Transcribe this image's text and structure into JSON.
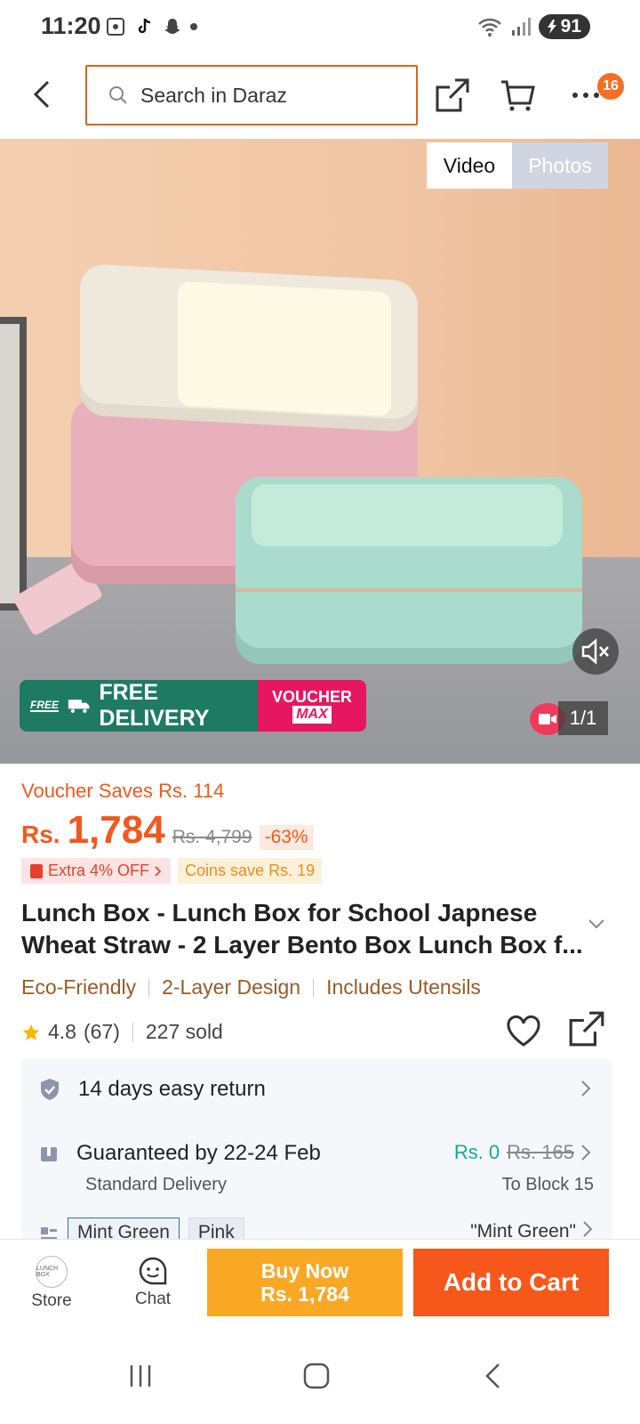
{
  "status_bar": {
    "time": "11:20",
    "battery": "91",
    "icons": [
      "screen-recorder-icon",
      "tiktok-icon",
      "snapchat-icon",
      "wifi-icon",
      "signal-icon"
    ]
  },
  "header": {
    "search_placeholder": "Search in Daraz",
    "cart_badge": "16"
  },
  "hero": {
    "tab_video": "Video",
    "tab_photos": "Photos",
    "free_tag": "FREE",
    "free_delivery": "FREE DELIVERY",
    "voucher_line1": "VOUCHER",
    "voucher_line2": "MAX",
    "page_counter": "1/1"
  },
  "price": {
    "voucher_saves": "Voucher Saves Rs. 114",
    "currency": "Rs.",
    "current": "1,784",
    "original": "Rs. 4,799",
    "discount": "-63%",
    "extra_off": "Extra 4% OFF",
    "coins_save": "Coins save Rs. 19"
  },
  "product": {
    "title": "Lunch Box - Lunch Box for School Japnese Wheat Straw - 2 Layer Bento Box Lunch Box f...",
    "features": [
      "Eco-Friendly",
      "2-Layer Design",
      "Includes Utensils"
    ],
    "rating": "4.8",
    "reviews": "(67)",
    "sold": "227 sold"
  },
  "service": {
    "return": "14 days easy return",
    "guarantee": "Guaranteed by 22-24 Feb",
    "delivery_type": "Standard Delivery",
    "delivery_fee": "Rs. 0",
    "delivery_fee_old": "Rs. 165",
    "destination": "To Block 15",
    "variants": [
      "Mint Green",
      "Pink"
    ],
    "selected_variant": "\"Mint Green\""
  },
  "action_bar": {
    "store": "Store",
    "store_logo_text": "LUNCH BOX",
    "chat": "Chat",
    "buy_now": "Buy Now",
    "buy_price": "Rs. 1,784",
    "add_to_cart": "Add to Cart"
  },
  "colors": {
    "brand_orange": "#f6571a",
    "buy_yellow": "#f9a825",
    "price_orange": "#f2581e",
    "teal": "#13a89e"
  }
}
